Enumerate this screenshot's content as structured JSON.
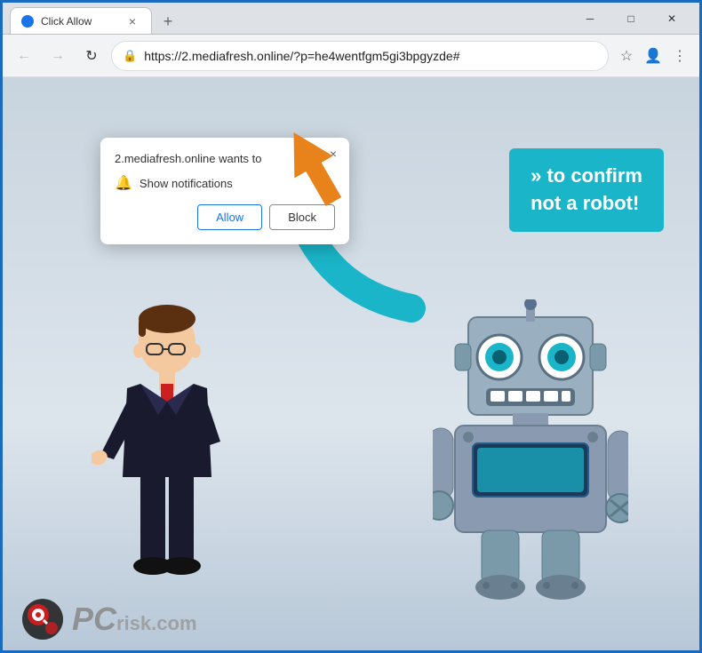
{
  "window": {
    "title": "Click Allow",
    "controls": {
      "minimize": "─",
      "maximize": "□",
      "close": "✕"
    }
  },
  "addressbar": {
    "url": "https://2.mediafresh.online/?p=he4wentfgm5gi3bpgyzde#",
    "lock_icon": "🔒"
  },
  "nav": {
    "back": "←",
    "forward": "→",
    "refresh": "↻"
  },
  "popup": {
    "title": "2.mediafresh.online wants to",
    "notification_label": "Show notifications",
    "allow_btn": "Allow",
    "block_btn": "Block",
    "close_btn": "×"
  },
  "banner": {
    "line1": "» to confirm",
    "line2": "not a robot!"
  },
  "watermark": {
    "text": "PC",
    "subtext": "risk.com"
  },
  "colors": {
    "accent_blue": "#1a73e8",
    "teal": "#1ab5c8",
    "orange_arrow": "#e8821a"
  }
}
